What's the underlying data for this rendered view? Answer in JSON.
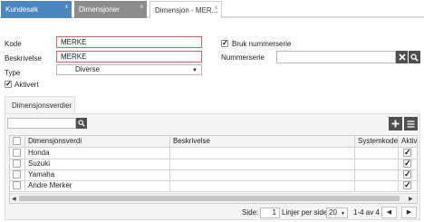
{
  "tabs": [
    {
      "label": "Kundesøk",
      "close": "x"
    },
    {
      "label": "Dimensjoner",
      "close": "x"
    },
    {
      "label": "Dimensjon - MER...",
      "close": "x"
    }
  ],
  "form": {
    "code_label": "Kode",
    "code_value": "MERKE",
    "description_label": "Beskrivelse",
    "description_value": "MERKE",
    "type_label": "Type",
    "type_value": "Diverse",
    "active_label": "Aktivert",
    "active_checked": true,
    "use_number_series_label": "Bruk nummerserie",
    "use_number_series_checked": true,
    "number_series_label": "Nummerserie",
    "number_series_value": ""
  },
  "panel": {
    "tab_label": "Dimensjonsverdier",
    "search_value": "",
    "columns": [
      "Dimensjonsverdi",
      "Beskrivelse",
      "Systemkode",
      "Aktivert"
    ],
    "rows": [
      {
        "value": "Honda",
        "description": "",
        "system_code": "",
        "active": true
      },
      {
        "value": "Suzuki",
        "description": "",
        "system_code": "",
        "active": true
      },
      {
        "value": "Yamaha",
        "description": "",
        "system_code": "",
        "active": true
      },
      {
        "value": "Andre Merker",
        "description": "",
        "system_code": "",
        "active": true
      }
    ],
    "pager": {
      "page_label": "Side:",
      "page_value": "1",
      "per_page_label": "Linjer per side:",
      "per_page_value": "20",
      "range": "1-4 av 4"
    }
  },
  "icons": {
    "tab_close": "close-icon",
    "clear": "clear-icon",
    "search": "search-icon",
    "add": "plus-icon",
    "menu": "menu-icon",
    "caret": "chevron-down-icon"
  },
  "colors": {
    "active_tab": "#4b86be",
    "inactive_tab": "#8c8c8c",
    "button_dark": "#4f4f4f",
    "required_border": "#c96666"
  }
}
